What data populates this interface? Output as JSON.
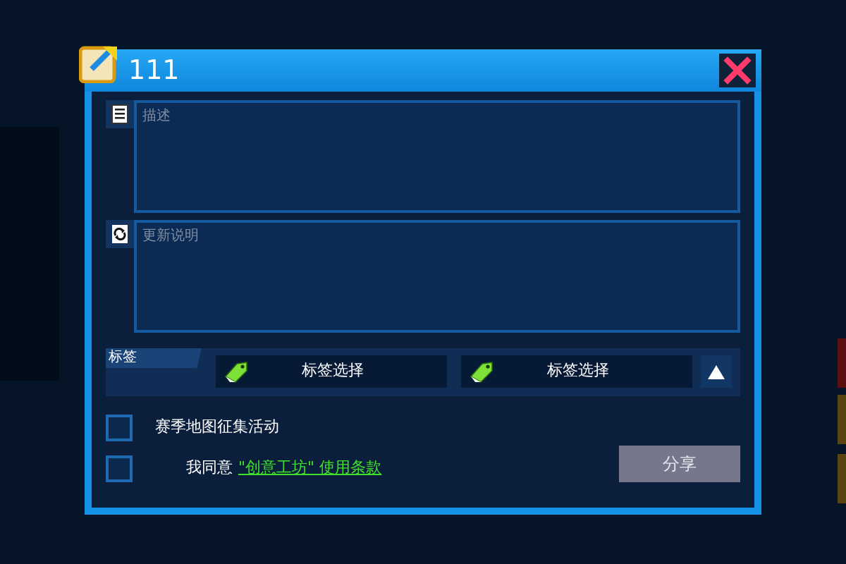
{
  "window": {
    "title": "111"
  },
  "fields": [
    {
      "kind": "document",
      "placeholder": "描述"
    },
    {
      "kind": "refresh",
      "placeholder": "更新说明"
    }
  ],
  "tags": {
    "label": "标签",
    "selectors": [
      {
        "text": "标签选择"
      },
      {
        "text": "标签选择"
      }
    ],
    "expanded": false
  },
  "options": [
    {
      "label": "赛季地图征集活动",
      "checked": false
    },
    {
      "label": "我同意",
      "link": "\"创意工坊\" 使用条款",
      "checked": false
    }
  ],
  "share_button": {
    "label": "分享",
    "disabled": true
  }
}
